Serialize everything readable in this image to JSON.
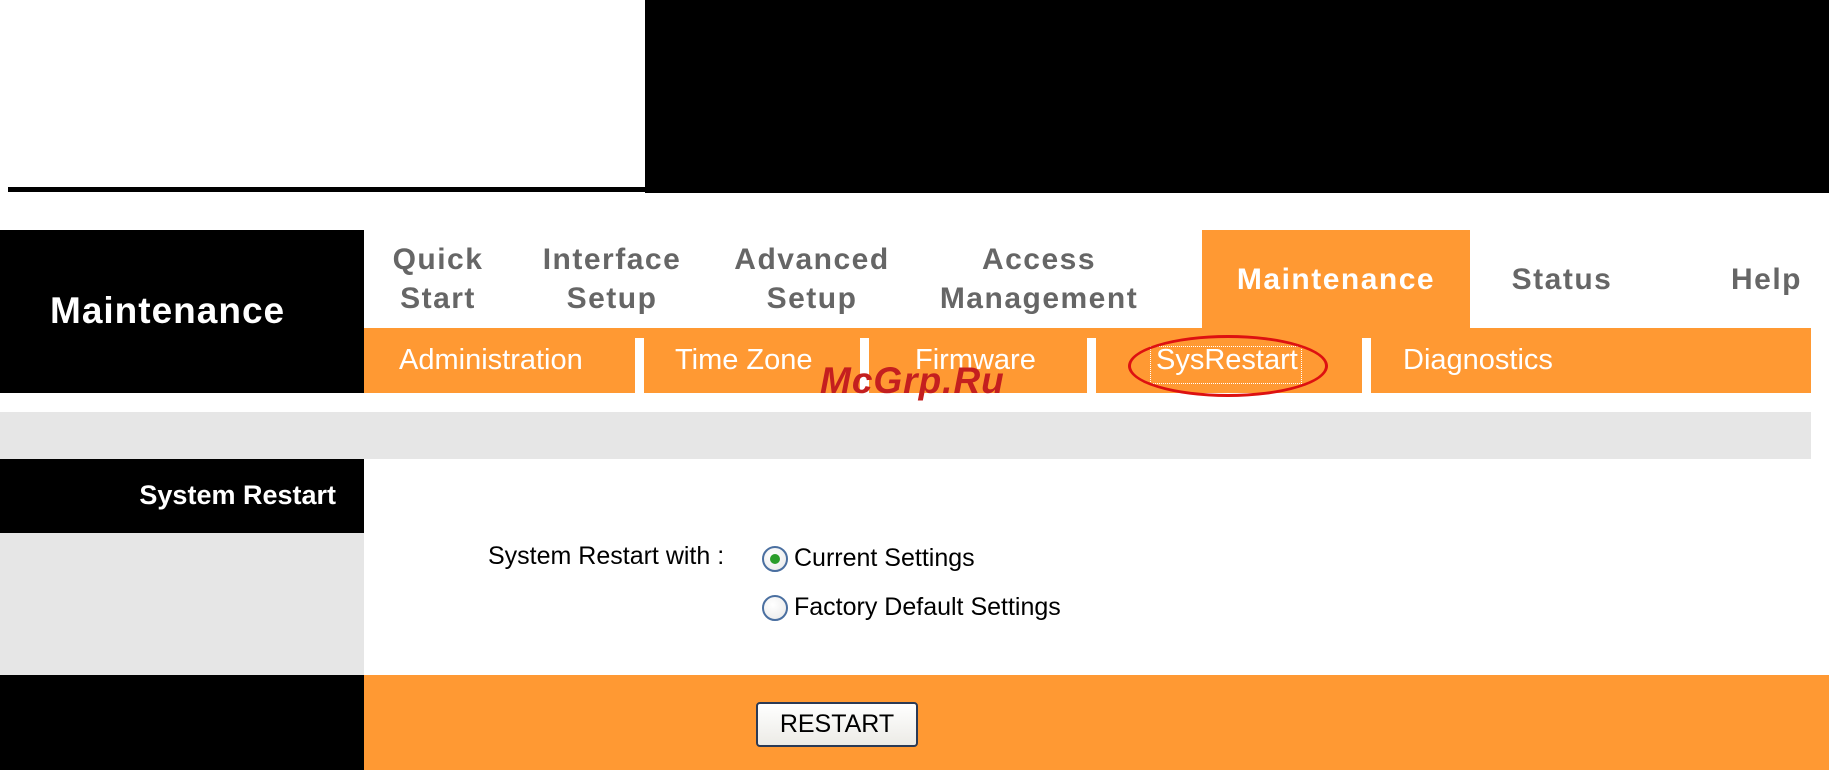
{
  "section_title": "Maintenance",
  "nav": {
    "items": [
      {
        "label_line1": "Quick",
        "label_line2": "Start"
      },
      {
        "label_line1": "Interface",
        "label_line2": "Setup"
      },
      {
        "label_line1": "Advanced",
        "label_line2": "Setup"
      },
      {
        "label_line1": "Access",
        "label_line2": "Management"
      },
      {
        "label": "Maintenance",
        "active": true
      },
      {
        "label": "Status"
      },
      {
        "label": "Help"
      }
    ]
  },
  "sub_nav": {
    "items": [
      {
        "label": "Administration"
      },
      {
        "label": "Time Zone"
      },
      {
        "label": "Firmware"
      },
      {
        "label": "SysRestart",
        "active": true
      },
      {
        "label": "Diagnostics"
      }
    ]
  },
  "watermark": "McGrp.Ru",
  "content": {
    "label": "System Restart",
    "form_label": "System Restart with :",
    "options": [
      {
        "label": "Current Settings",
        "checked": true
      },
      {
        "label": "Factory Default Settings",
        "checked": false
      }
    ],
    "button_label": "RESTART"
  },
  "colors": {
    "accent": "#ff9933",
    "highlight_ring": "#dd1111",
    "watermark": "#c41f1f"
  }
}
